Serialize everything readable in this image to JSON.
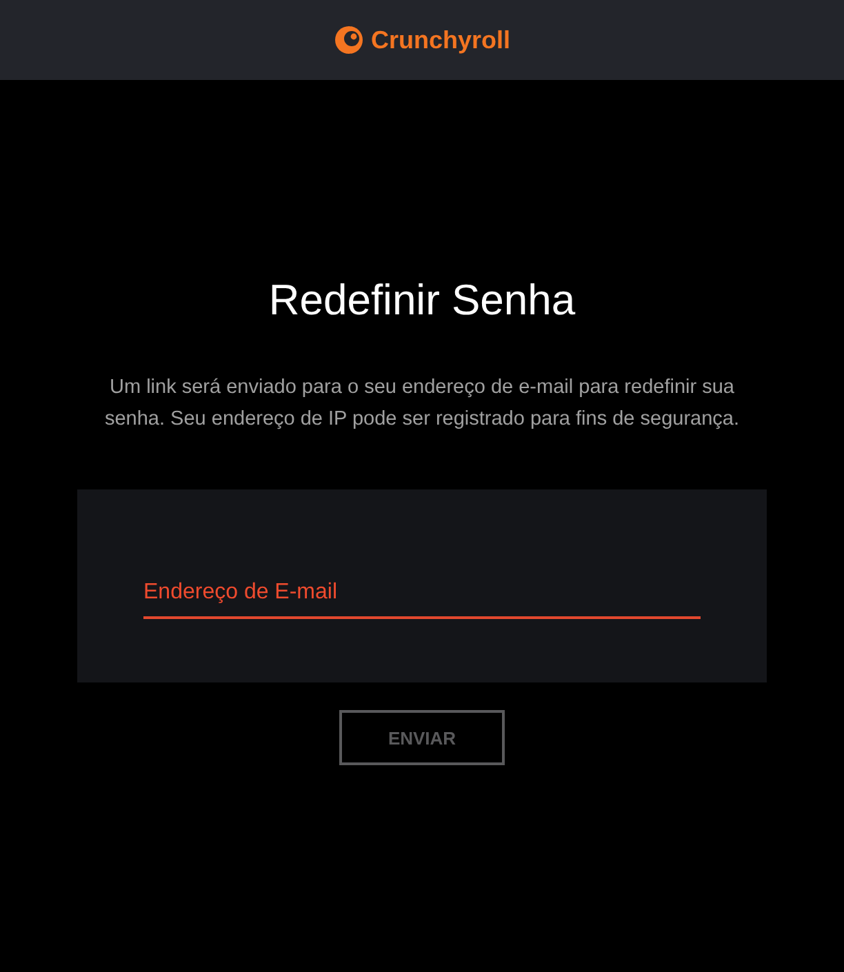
{
  "header": {
    "brand": "Crunchyroll"
  },
  "title": "Redefinir Senha",
  "description": "Um link será enviado para o seu endereço de e-mail para redefinir sua senha. Seu endereço de IP pode ser registrado para fins de segurança.",
  "email_field": {
    "placeholder": "Endereço de E-mail",
    "focused": true
  },
  "submit": {
    "label": "ENVIAR",
    "disabled": true
  }
}
